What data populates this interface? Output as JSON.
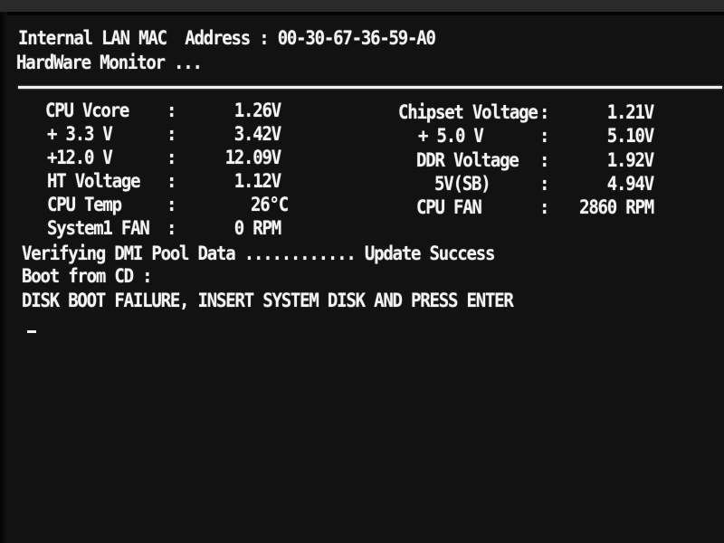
{
  "header": {
    "mac_line": "Internal LAN MAC  Address : 00-30-67-36-59-A0",
    "monitor_title": "HardWare Monitor ..."
  },
  "hardware_monitor": {
    "separator": ":",
    "left": [
      {
        "label": "CPU Vcore",
        "value": "1.26V"
      },
      {
        "label": "+ 3.3 V",
        "value": "3.42V"
      },
      {
        "label": "+12.0 V",
        "value": "12.09V"
      },
      {
        "label": "HT Voltage",
        "value": "1.12V"
      },
      {
        "label": "CPU Temp",
        "value": "26°C"
      },
      {
        "label": "System1 FAN",
        "value": "0 RPM"
      }
    ],
    "right": [
      {
        "label": "Chipset Voltage",
        "value": "1.21V"
      },
      {
        "label": "+ 5.0 V",
        "value": "5.10V"
      },
      {
        "label": "DDR Voltage",
        "value": "1.92V"
      },
      {
        "label": "5V(SB)",
        "value": "4.94V"
      },
      {
        "label": "CPU FAN",
        "value": "2860 RPM"
      }
    ]
  },
  "boot": {
    "dmi_line": "Verifying DMI Pool Data ............ Update Success",
    "boot_from": "Boot from CD :",
    "error_message": "DISK BOOT FAILURE, INSERT SYSTEM DISK AND PRESS ENTER"
  }
}
